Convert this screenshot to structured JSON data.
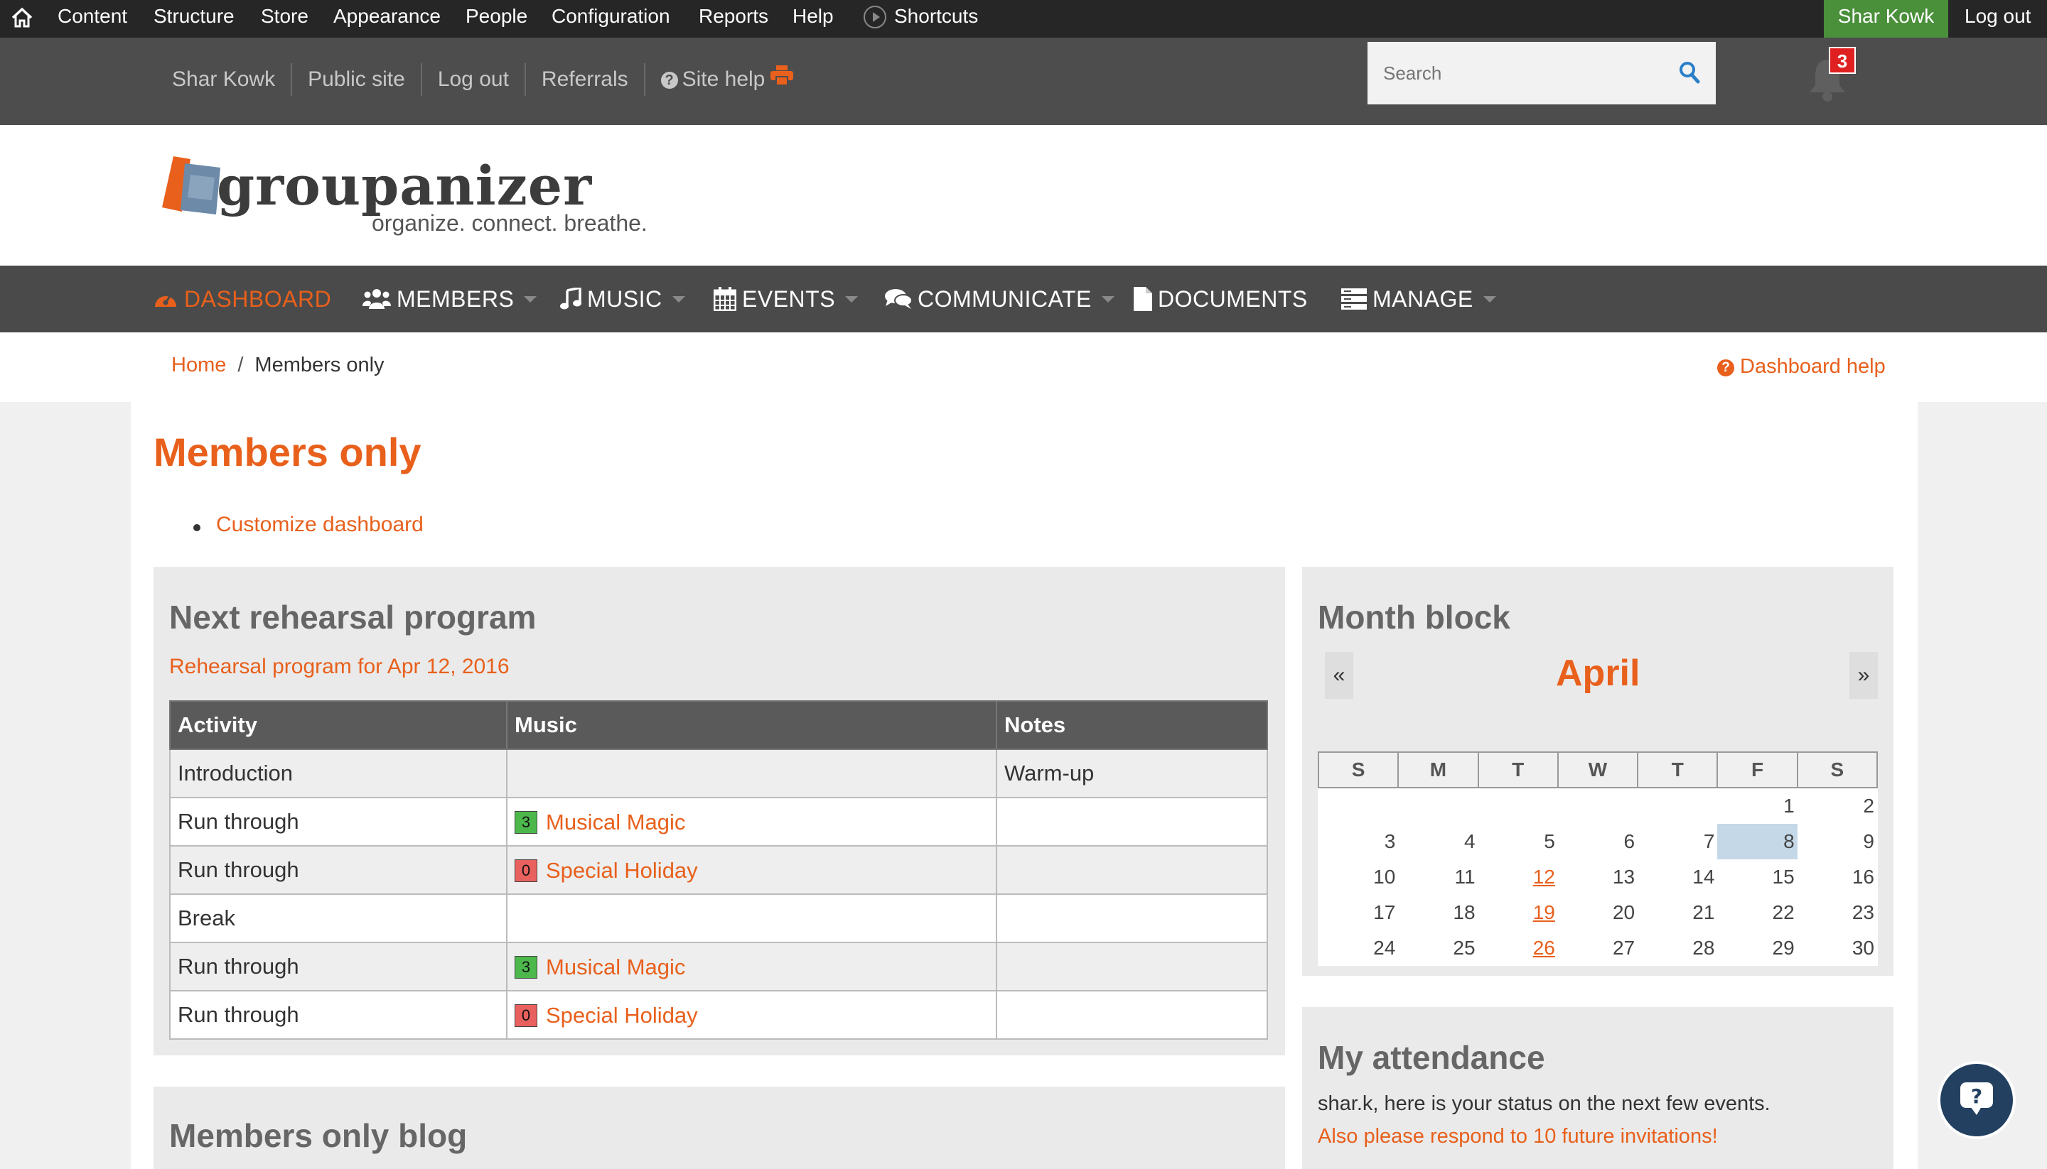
{
  "admin_bar": {
    "items": [
      "Content",
      "Structure",
      "Store",
      "Appearance",
      "People",
      "Configuration",
      "Reports",
      "Help",
      "Shortcuts"
    ],
    "user": "Shar Kowk",
    "logout": "Log out"
  },
  "util_bar": {
    "links": [
      "Shar Kowk",
      "Public site",
      "Log out",
      "Referrals",
      "Site help"
    ],
    "search_placeholder": "Search",
    "notification_count": "3"
  },
  "logo": {
    "wordmark": "groupanizer",
    "tagline": "organize. connect. breathe."
  },
  "main_nav": {
    "items": [
      {
        "label": "DASHBOARD",
        "active": true
      },
      {
        "label": "MEMBERS",
        "caret": true
      },
      {
        "label": "MUSIC",
        "caret": true
      },
      {
        "label": "EVENTS",
        "caret": true
      },
      {
        "label": "COMMUNICATE",
        "caret": true
      },
      {
        "label": "DOCUMENTS"
      },
      {
        "label": "MANAGE",
        "caret": true
      }
    ]
  },
  "breadcrumb": {
    "home": "Home",
    "separator": "/",
    "current": "Members only"
  },
  "dashboard_help": "Dashboard help",
  "page_title": "Members only",
  "customize_link": "Customize dashboard",
  "rehearsal": {
    "title": "Next rehearsal program",
    "subtitle": "Rehearsal program for Apr 12, 2016",
    "headers": [
      "Activity",
      "Music",
      "Notes"
    ],
    "rows": [
      {
        "activity": "Introduction",
        "badge": "",
        "music": "",
        "notes": "Warm-up"
      },
      {
        "activity": "Run through",
        "badge": "3",
        "music": "Musical Magic",
        "notes": ""
      },
      {
        "activity": "Run through",
        "badge": "0",
        "music": "Special Holiday",
        "notes": ""
      },
      {
        "activity": "Break",
        "badge": "",
        "music": "",
        "notes": ""
      },
      {
        "activity": "Run through",
        "badge": "3",
        "music": "Musical Magic",
        "notes": ""
      },
      {
        "activity": "Run through",
        "badge": "0",
        "music": "Special Holiday",
        "notes": ""
      }
    ]
  },
  "blog": {
    "title": "Members only blog"
  },
  "month_block": {
    "title": "Month block",
    "month": "April",
    "prev": "«",
    "next": "»",
    "weekdays": [
      "S",
      "M",
      "T",
      "W",
      "T",
      "F",
      "S"
    ],
    "weeks": [
      [
        "",
        "",
        "",
        "",
        "",
        "1",
        "2"
      ],
      [
        "3",
        "4",
        "5",
        "6",
        "7",
        "8",
        "9"
      ],
      [
        "10",
        "11",
        "12",
        "13",
        "14",
        "15",
        "16"
      ],
      [
        "17",
        "18",
        "19",
        "20",
        "21",
        "22",
        "23"
      ],
      [
        "24",
        "25",
        "26",
        "27",
        "28",
        "29",
        "30"
      ]
    ],
    "today": "8",
    "linked_days": [
      "12",
      "19",
      "26"
    ]
  },
  "attendance": {
    "title": "My attendance",
    "status_text": "shar.k, here is your status on the next few events.",
    "respond_link": "Also please respond to 10 future invitations!"
  },
  "colors": {
    "accent": "#e8601c",
    "admin_bar": "#262626",
    "util_bar": "#4d4d4d",
    "nav_bar": "#4a4a4a",
    "user_button": "#4a8f3a",
    "badge_green": "#4cb84c",
    "badge_red": "#e9615e",
    "today_highlight": "#c5d8e8",
    "help_fab": "#234061"
  }
}
